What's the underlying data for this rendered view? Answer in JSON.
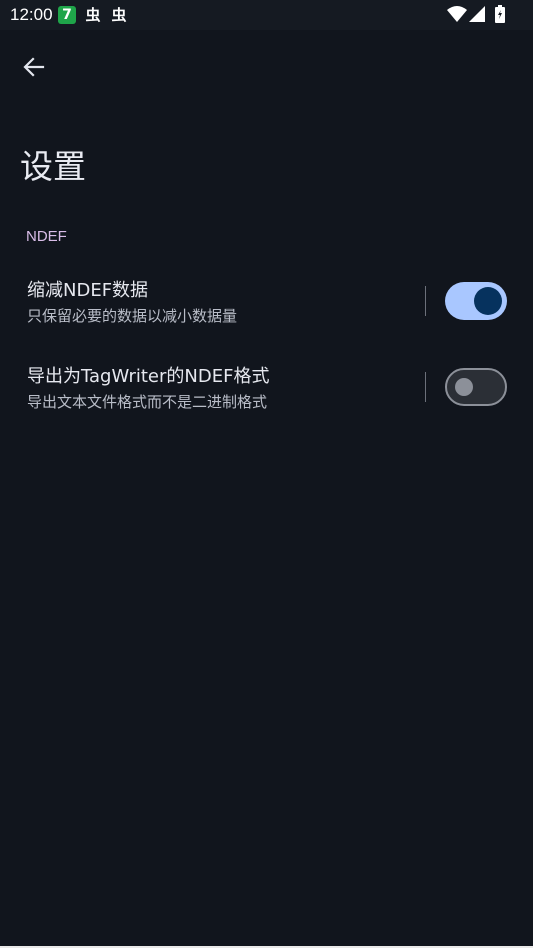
{
  "status_bar": {
    "time": "12:00",
    "notifications": [
      {
        "icon": "app-7-icon",
        "glyph": "7"
      },
      {
        "icon": "bug-icon",
        "glyph": "虫"
      },
      {
        "icon": "bug-icon",
        "glyph": "虫"
      }
    ],
    "system_icons": [
      "wifi-icon",
      "cellular-signal-icon",
      "battery-icon"
    ]
  },
  "toolbar": {
    "back_icon": "arrow-back-icon"
  },
  "page": {
    "title": "设置"
  },
  "section": {
    "header": "NDEF",
    "accent_color": "#d9bde8"
  },
  "preferences": [
    {
      "title": "缩减NDEF数据",
      "summary": "只保留必要的数据以减小数据量",
      "enabled": true
    },
    {
      "title": "导出为TagWriter的NDEF格式",
      "summary": "导出文本文件格式而不是二进制格式",
      "enabled": false
    }
  ],
  "colors": {
    "background": "#11151d",
    "switch_on_track": "#a9c7ff",
    "switch_on_thumb": "#06325e",
    "switch_off_outline": "#8c9099"
  }
}
